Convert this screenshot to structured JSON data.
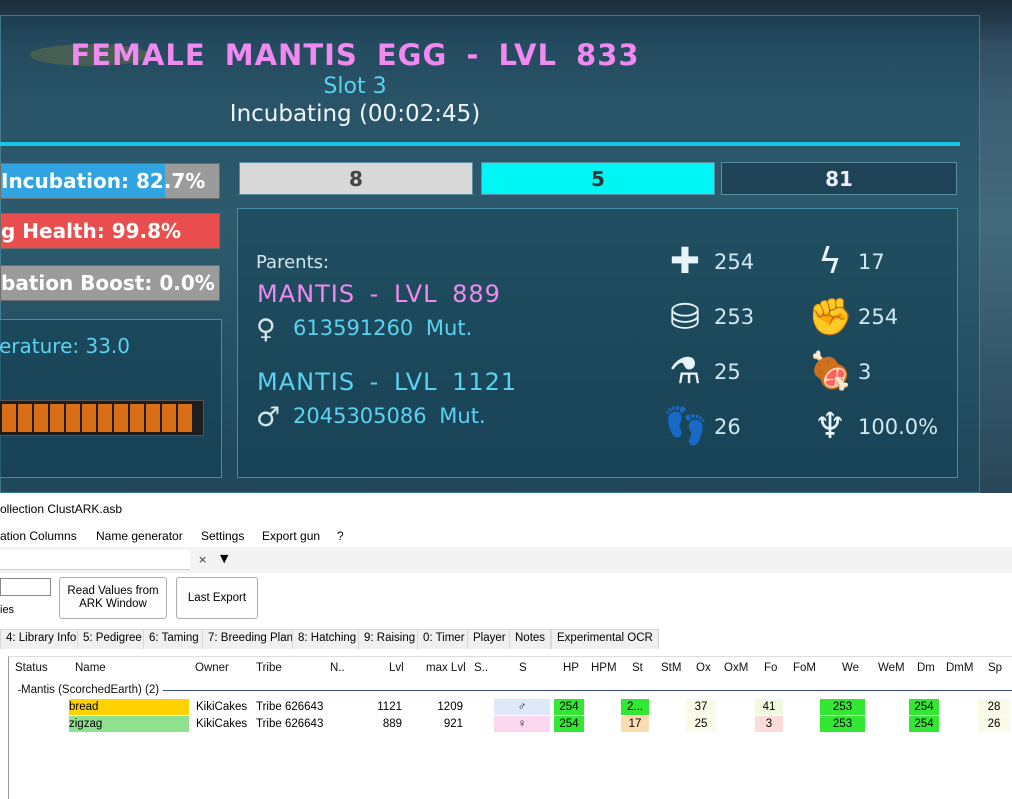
{
  "game": {
    "egg_title": "FEMALE  MANTIS  EGG  -  LVL  833",
    "slot": "Slot 3",
    "status": "Incubating (00:02:45)",
    "incubation_label": "Incubation: 82.7%",
    "incubation_progress": 0.75,
    "health_label": "g Health: 99.8%",
    "health_progress": 0.998,
    "boost_label": "bation Boost: 0.0%",
    "temperature_label": "erature:  33.0",
    "temp_segments": 12,
    "boxes": [
      "8",
      "5",
      "81"
    ],
    "parents_label": "Parents:",
    "mother": {
      "name": "MANTIS  -  LVL  889",
      "mutations": "613591260  Mut."
    },
    "father": {
      "name": "MANTIS  -  LVL  1121",
      "mutations": "2045305086  Mut."
    },
    "stats": [
      {
        "icon": "health-icon",
        "value": "254"
      },
      {
        "icon": "stamina-icon",
        "value": "17"
      },
      {
        "icon": "weight-icon",
        "value": "253"
      },
      {
        "icon": "melee-icon",
        "value": "254"
      },
      {
        "icon": "oxygen-icon",
        "value": "25"
      },
      {
        "icon": "food-icon",
        "value": "3"
      },
      {
        "icon": "speed-icon",
        "value": "26"
      },
      {
        "icon": "imprint-icon",
        "value": "100.0%"
      }
    ]
  },
  "app": {
    "title": "ollection ClustARK.asb",
    "menu": [
      "ation Columns",
      "Name generator",
      "Settings",
      "Export gun",
      "?"
    ],
    "clear_symbol": "×",
    "filter_symbol": "▼",
    "species_label": "ies",
    "btn_read": "Read Values from ARK Window",
    "btn_last": "Last Export",
    "tabs": [
      "4: Library Info",
      "5: Pedigree",
      "6: Taming",
      "7: Breeding Plan",
      "8: Hatching",
      "9: Raising",
      "0: Timer",
      "Player",
      "Notes",
      "Experimental OCR"
    ],
    "columns": [
      "Status",
      "Name",
      "Owner",
      "Tribe",
      "N..",
      "Lvl",
      "max Lvl",
      "S..",
      "S",
      "HP",
      "HPM",
      "St",
      "StM",
      "Ox",
      "OxM",
      "Fo",
      "FoM",
      "We",
      "WeM",
      "Dm",
      "DmM",
      "Sp"
    ],
    "group": "Mantis (ScorchedEarth) (2)",
    "rows": [
      {
        "name": "bread",
        "owner": "KikiCakes",
        "tribe": "Tribe 626643",
        "lvl": "1121",
        "max": "1209",
        "sex": "♂",
        "hp": "254",
        "st": "2...",
        "ox": "37",
        "fo": "41",
        "we": "253",
        "dm": "254",
        "sp": "28"
      },
      {
        "name": "zigzag",
        "owner": "KikiCakes",
        "tribe": "Tribe 626643",
        "lvl": "889",
        "max": "921",
        "sex": "♀",
        "hp": "254",
        "st": "17",
        "ox": "25",
        "fo": "3",
        "we": "253",
        "dm": "254",
        "sp": "26"
      }
    ],
    "colors": {
      "name1": "#ffd200",
      "name2": "#8fe08f",
      "hi": "#33e833",
      "sex1": "#dde8f8",
      "sex2": "#fbd8ef"
    }
  }
}
